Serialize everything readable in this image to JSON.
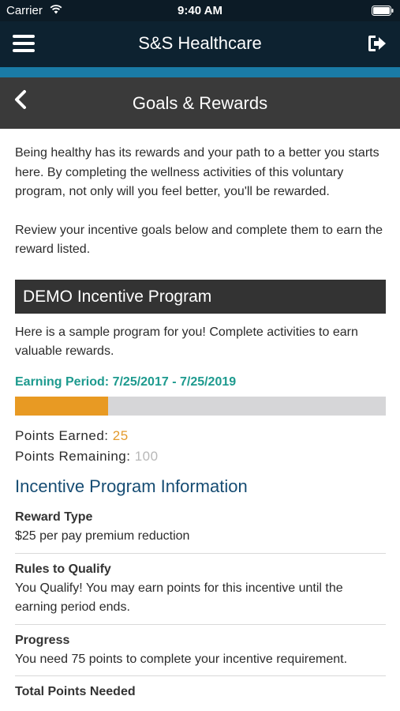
{
  "status_bar": {
    "carrier": "Carrier",
    "time": "9:40 AM"
  },
  "app_bar": {
    "title": "S&S Healthcare",
    "menu_icon": "hamburger-menu-icon",
    "logout_icon": "logout-icon"
  },
  "sub_bar": {
    "title": "Goals & Rewards",
    "back_icon": "chevron-left-icon"
  },
  "intro": {
    "paragraph1": "Being healthy has its rewards and your path to a better you starts here. By completing the wellness activities of this voluntary program, not only will you feel better, you'll be rewarded.",
    "paragraph2": "Review your incentive goals below and complete them to earn the reward listed."
  },
  "program": {
    "name": "DEMO Incentive Program",
    "description": "Here is a sample program for you! Complete activities to earn valuable rewards.",
    "earning_period": "Earning Period: 7/25/2017 - 7/25/2019",
    "progress_fraction": 0.25,
    "points_earned_label": "Points Earned:",
    "points_earned_value": "25",
    "points_remaining_label": "Points Remaining:",
    "points_remaining_value": "100"
  },
  "info": {
    "title": "Incentive Program Information",
    "rows": [
      {
        "label": "Reward Type",
        "value": "$25 per pay premium reduction"
      },
      {
        "label": "Rules to Qualify",
        "value": "You Qualify! You may earn points for this incentive until the earning period ends."
      },
      {
        "label": "Progress",
        "value": "You need 75 points to complete your incentive requirement."
      },
      {
        "label": "Total Points Needed",
        "value": ""
      }
    ]
  },
  "colors": {
    "app_bar": "#0d2230",
    "accent": "#1a7ba6",
    "sub_bar": "#3a3a3a",
    "earning_period": "#1d9a8e",
    "progress_fill": "#e89a23",
    "progress_track": "#d6d6d8",
    "info_title": "#164c73"
  }
}
